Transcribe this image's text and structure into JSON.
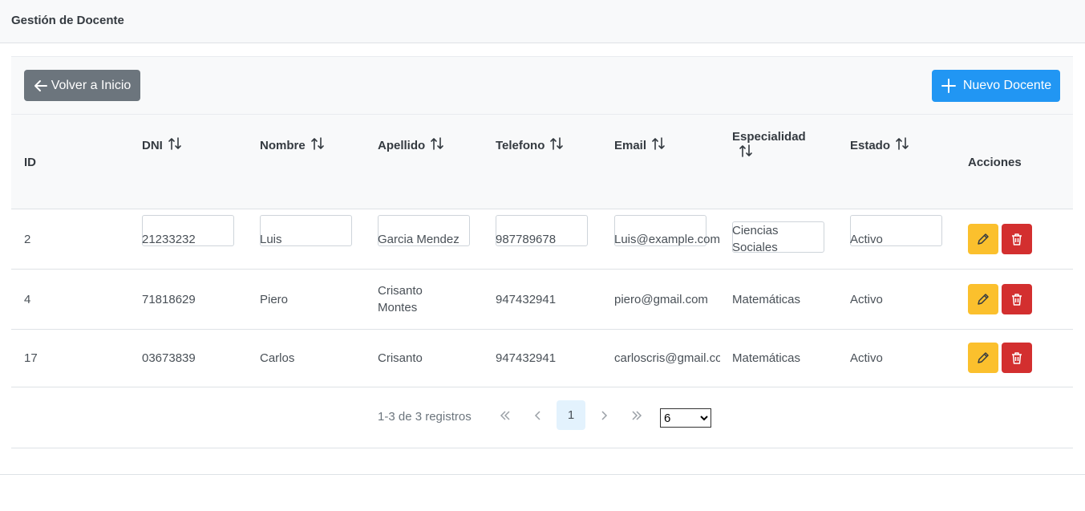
{
  "header": {
    "title": "Gestión de Docente"
  },
  "toolbar": {
    "back_label": "Volver a Inicio",
    "new_label": "Nuevo Docente"
  },
  "columns": {
    "id": "ID",
    "dni": "DNI",
    "nombre": "Nombre",
    "apellido": "Apellido",
    "telefono": "Telefono",
    "email": "Email",
    "especialidad": "Especialidad",
    "estado": "Estado",
    "acciones": "Acciones"
  },
  "rows": [
    {
      "id": "2",
      "dni": "21233232",
      "nombre": "Luis",
      "apellido_1": "Garcia Mendez",
      "apellido_2": "",
      "telefono": "987789678",
      "email": "Luis@example.com",
      "especialidad_1": "Ciencias",
      "especialidad_2": "Sociales",
      "estado": "Activo"
    },
    {
      "id": "4",
      "dni": "71818629",
      "nombre": "Piero",
      "apellido_1": "Crisanto",
      "apellido_2": "Montes",
      "telefono": "947432941",
      "email": "piero@gmail.com",
      "especialidad_1": "Matemáticas",
      "especialidad_2": "",
      "estado": "Activo"
    },
    {
      "id": "17",
      "dni": "03673839",
      "nombre": "Carlos",
      "apellido_1": "Crisanto",
      "apellido_2": "",
      "telefono": "947432941",
      "email": "carloscris@gmail.com",
      "especialidad_1": "Matemáticas",
      "especialidad_2": "",
      "estado": "Activo"
    }
  ],
  "pagination": {
    "info": "1-3 de 3 registros",
    "current_page": "1",
    "rows_per_page": "6",
    "rows_per_page_options": [
      "6"
    ]
  },
  "icons": {
    "back": "arrow-left-icon",
    "new": "plus-icon",
    "sort": "sort-arrows-icon",
    "edit": "pencil-icon",
    "delete": "trash-icon",
    "first": "double-chevron-left-icon",
    "prev": "chevron-left-icon",
    "next": "chevron-right-icon",
    "last": "double-chevron-right-icon"
  },
  "colors": {
    "back_button": "#6c757d",
    "new_button": "#2196f3",
    "edit_button": "#fbc02d",
    "delete_button": "#d32f2f",
    "active_page": "#e3f2fd"
  }
}
